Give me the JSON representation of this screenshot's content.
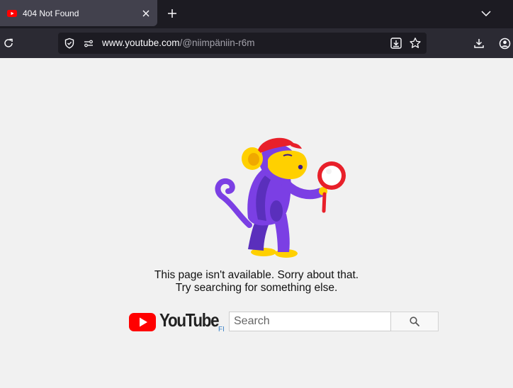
{
  "browser": {
    "tab": {
      "title": "404 Not Found"
    },
    "url": {
      "domain": "www.youtube.com",
      "path": "/@niimpäniin-r6m"
    },
    "icons": [
      "youtube-favicon",
      "close-icon",
      "plus-icon",
      "chevron-down-icon",
      "reload-icon",
      "shield-icon",
      "permissions-icon",
      "page-download-icon",
      "star-icon",
      "download-icon",
      "account-icon"
    ]
  },
  "page": {
    "message_line1": "This page isn't available. Sorry about that.",
    "message_line2": "Try searching for something else.",
    "logo_text": "YouTube",
    "country_code": "FI",
    "search": {
      "placeholder": "Search"
    }
  },
  "colors": {
    "youtube_red": "#ff0000",
    "monkey_purple": "#7b3fe4",
    "monkey_yellow": "#ffd000",
    "cap_red": "#e8202a"
  }
}
